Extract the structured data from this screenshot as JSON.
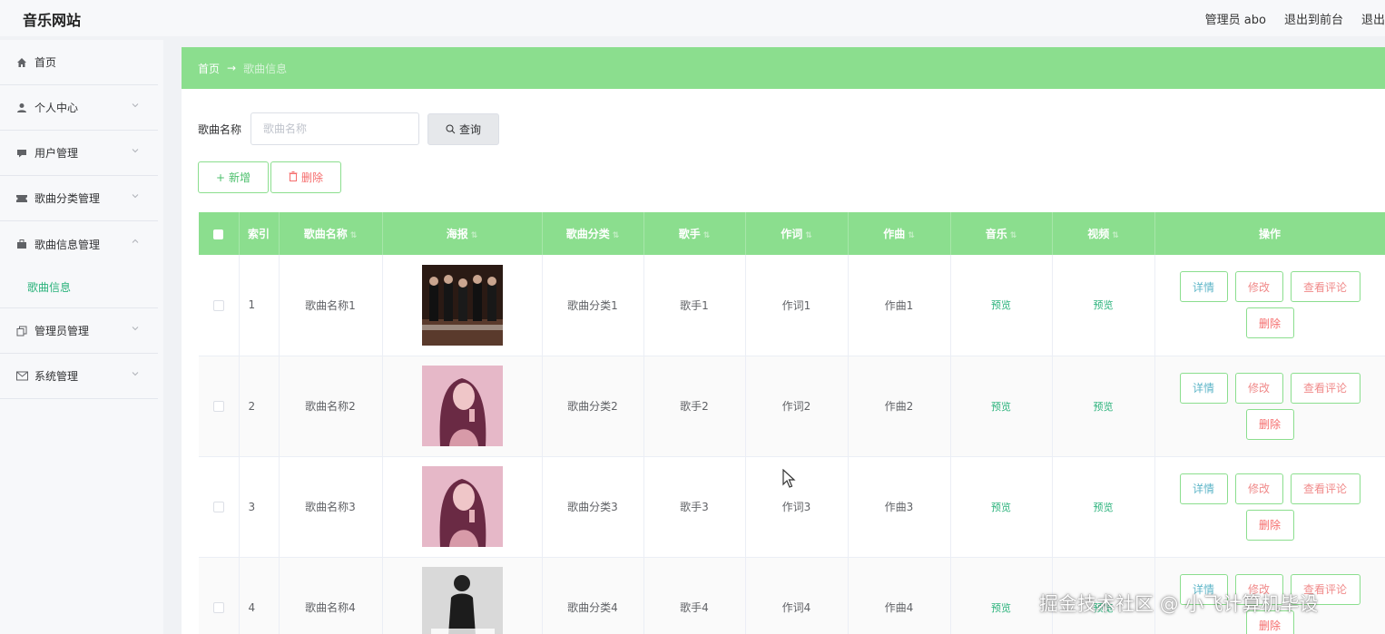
{
  "header": {
    "logo": "音乐网站",
    "admin": "管理员 abo",
    "to_front": "退出到前台",
    "logout": "退出"
  },
  "sidebar": {
    "items": [
      {
        "label": "首页",
        "icon": "home-icon"
      },
      {
        "label": "个人中心",
        "icon": "user-icon"
      },
      {
        "label": "用户管理",
        "icon": "message-icon"
      },
      {
        "label": "歌曲分类管理",
        "icon": "ticket-icon"
      },
      {
        "label": "歌曲信息管理",
        "icon": "suitcase-icon"
      },
      {
        "label": "管理员管理",
        "icon": "copy-icon"
      },
      {
        "label": "系统管理",
        "icon": "mail-icon"
      }
    ],
    "submenu_label": "歌曲信息"
  },
  "breadcrumb": {
    "home": "首页",
    "arrow": "→",
    "current": "歌曲信息"
  },
  "search": {
    "label": "歌曲名称",
    "placeholder": "歌曲名称",
    "button": "查询"
  },
  "actions": {
    "add": "新增",
    "delete": "删除"
  },
  "table": {
    "headers": [
      "索引",
      "歌曲名称",
      "海报",
      "歌曲分类",
      "歌手",
      "作词",
      "作曲",
      "音乐",
      "视频",
      "操作"
    ],
    "rows": [
      {
        "index": "1",
        "name": "歌曲名称1",
        "category": "歌曲分类1",
        "singer": "歌手1",
        "lyricist": "作词1",
        "composer": "作曲1",
        "music": "预览",
        "video": "预览"
      },
      {
        "index": "2",
        "name": "歌曲名称2",
        "category": "歌曲分类2",
        "singer": "歌手2",
        "lyricist": "作词2",
        "composer": "作曲2",
        "music": "预览",
        "video": "预览"
      },
      {
        "index": "3",
        "name": "歌曲名称3",
        "category": "歌曲分类3",
        "singer": "歌手3",
        "lyricist": "作词3",
        "composer": "作曲3",
        "music": "预览",
        "video": "预览"
      },
      {
        "index": "4",
        "name": "歌曲名称4",
        "category": "歌曲分类4",
        "singer": "歌手4",
        "lyricist": "作词4",
        "composer": "作曲4",
        "music": "预览",
        "video": "预览"
      }
    ],
    "op_labels": {
      "detail": "详情",
      "edit": "修改",
      "comment": "查看评论",
      "remove": "删除"
    }
  },
  "watermark": "掘金技术社区 @ 小飞计算机毕设",
  "colors": {
    "accent": "#8bde8e",
    "link": "#2ab27b",
    "danger": "#f56c6c"
  }
}
